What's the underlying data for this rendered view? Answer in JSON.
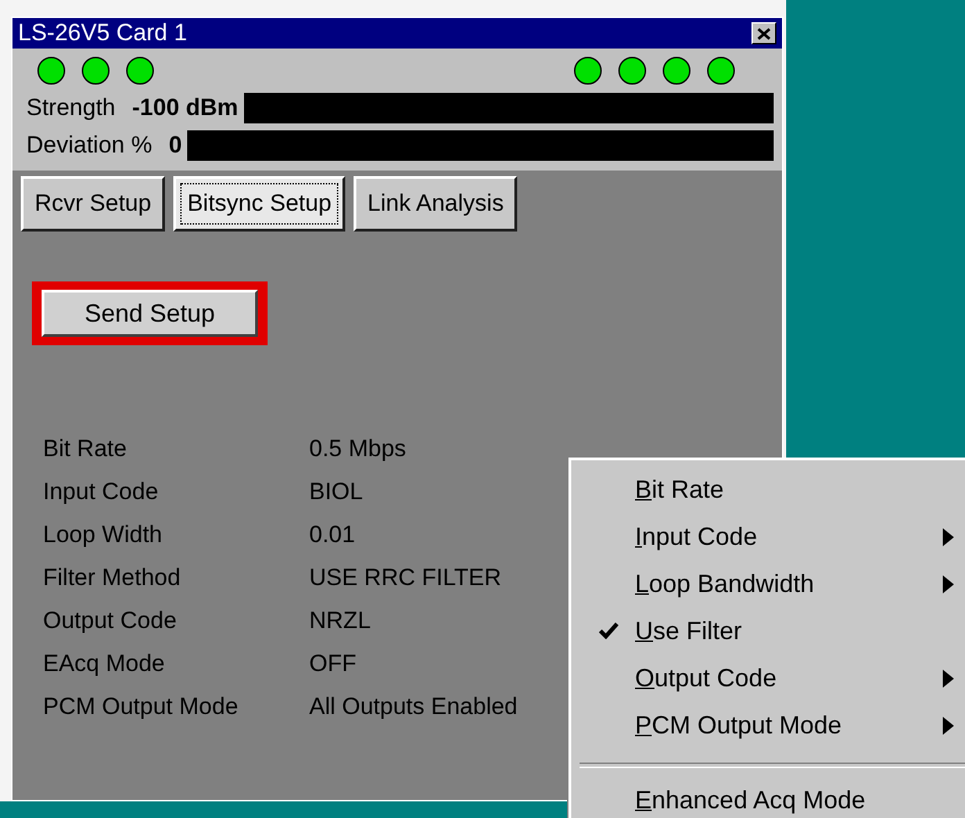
{
  "window": {
    "title": "LS-26V5 Card 1"
  },
  "lights_left": [
    {
      "on": true
    },
    {
      "on": true
    },
    {
      "on": true
    }
  ],
  "lights_right": [
    {
      "on": true
    },
    {
      "on": true
    },
    {
      "on": true
    },
    {
      "on": true
    }
  ],
  "meters": [
    {
      "label": "Strength",
      "reading": "-100 dBm"
    },
    {
      "label": "Deviation %",
      "reading": "0"
    }
  ],
  "tabs": [
    {
      "label": "Rcvr Setup",
      "selected": false
    },
    {
      "label": "Bitsync Setup",
      "selected": true
    },
    {
      "label": "Link Analysis",
      "selected": false
    }
  ],
  "send_button": {
    "label": "Send Setup",
    "highlighted": true
  },
  "parameters": [
    {
      "name": "Bit Rate",
      "value": "0.5 Mbps"
    },
    {
      "name": "Input Code",
      "value": "BIOL"
    },
    {
      "name": "Loop Width",
      "value": "0.01"
    },
    {
      "name": "Filter Method",
      "value": "USE RRC FILTER"
    },
    {
      "name": "Output Code",
      "value": "NRZL"
    },
    {
      "name": "EAcq Mode",
      "value": "OFF"
    },
    {
      "name": "PCM Output Mode",
      "value": "All Outputs Enabled"
    }
  ],
  "context_menu": [
    {
      "kind": "item",
      "label": "Bit Rate",
      "checked": false,
      "submenu": false
    },
    {
      "kind": "item",
      "label": "Input Code",
      "checked": false,
      "submenu": true
    },
    {
      "kind": "item",
      "label": "Loop Bandwidth",
      "checked": false,
      "submenu": true
    },
    {
      "kind": "item",
      "label": "Use Filter",
      "checked": true,
      "submenu": false
    },
    {
      "kind": "item",
      "label": "Output Code",
      "checked": false,
      "submenu": true
    },
    {
      "kind": "item",
      "label": "PCM Output Mode",
      "checked": false,
      "submenu": true
    },
    {
      "kind": "separator"
    },
    {
      "kind": "item",
      "label": "Enhanced Acq Mode",
      "checked": false,
      "submenu": false
    }
  ]
}
